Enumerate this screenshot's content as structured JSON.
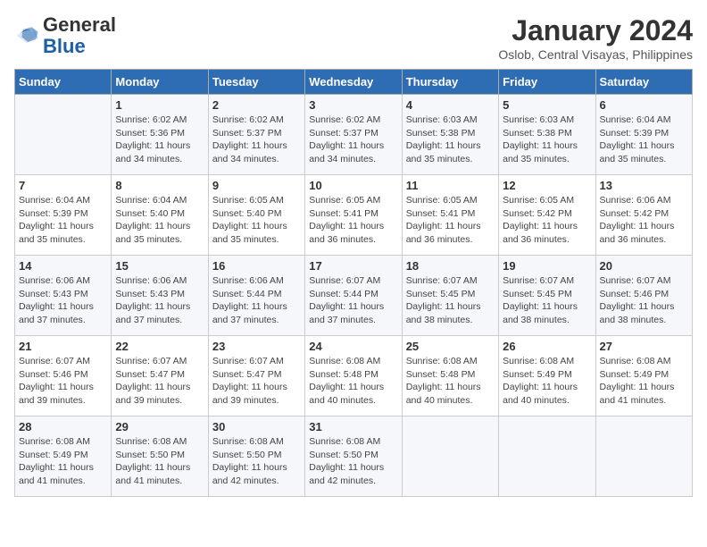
{
  "header": {
    "logo_general": "General",
    "logo_blue": "Blue",
    "month_title": "January 2024",
    "location": "Oslob, Central Visayas, Philippines"
  },
  "weekdays": [
    "Sunday",
    "Monday",
    "Tuesday",
    "Wednesday",
    "Thursday",
    "Friday",
    "Saturday"
  ],
  "weeks": [
    [
      {
        "day": "",
        "info": ""
      },
      {
        "day": "1",
        "info": "Sunrise: 6:02 AM\nSunset: 5:36 PM\nDaylight: 11 hours\nand 34 minutes."
      },
      {
        "day": "2",
        "info": "Sunrise: 6:02 AM\nSunset: 5:37 PM\nDaylight: 11 hours\nand 34 minutes."
      },
      {
        "day": "3",
        "info": "Sunrise: 6:02 AM\nSunset: 5:37 PM\nDaylight: 11 hours\nand 34 minutes."
      },
      {
        "day": "4",
        "info": "Sunrise: 6:03 AM\nSunset: 5:38 PM\nDaylight: 11 hours\nand 35 minutes."
      },
      {
        "day": "5",
        "info": "Sunrise: 6:03 AM\nSunset: 5:38 PM\nDaylight: 11 hours\nand 35 minutes."
      },
      {
        "day": "6",
        "info": "Sunrise: 6:04 AM\nSunset: 5:39 PM\nDaylight: 11 hours\nand 35 minutes."
      }
    ],
    [
      {
        "day": "7",
        "info": "Sunrise: 6:04 AM\nSunset: 5:39 PM\nDaylight: 11 hours\nand 35 minutes."
      },
      {
        "day": "8",
        "info": "Sunrise: 6:04 AM\nSunset: 5:40 PM\nDaylight: 11 hours\nand 35 minutes."
      },
      {
        "day": "9",
        "info": "Sunrise: 6:05 AM\nSunset: 5:40 PM\nDaylight: 11 hours\nand 35 minutes."
      },
      {
        "day": "10",
        "info": "Sunrise: 6:05 AM\nSunset: 5:41 PM\nDaylight: 11 hours\nand 36 minutes."
      },
      {
        "day": "11",
        "info": "Sunrise: 6:05 AM\nSunset: 5:41 PM\nDaylight: 11 hours\nand 36 minutes."
      },
      {
        "day": "12",
        "info": "Sunrise: 6:05 AM\nSunset: 5:42 PM\nDaylight: 11 hours\nand 36 minutes."
      },
      {
        "day": "13",
        "info": "Sunrise: 6:06 AM\nSunset: 5:42 PM\nDaylight: 11 hours\nand 36 minutes."
      }
    ],
    [
      {
        "day": "14",
        "info": "Sunrise: 6:06 AM\nSunset: 5:43 PM\nDaylight: 11 hours\nand 37 minutes."
      },
      {
        "day": "15",
        "info": "Sunrise: 6:06 AM\nSunset: 5:43 PM\nDaylight: 11 hours\nand 37 minutes."
      },
      {
        "day": "16",
        "info": "Sunrise: 6:06 AM\nSunset: 5:44 PM\nDaylight: 11 hours\nand 37 minutes."
      },
      {
        "day": "17",
        "info": "Sunrise: 6:07 AM\nSunset: 5:44 PM\nDaylight: 11 hours\nand 37 minutes."
      },
      {
        "day": "18",
        "info": "Sunrise: 6:07 AM\nSunset: 5:45 PM\nDaylight: 11 hours\nand 38 minutes."
      },
      {
        "day": "19",
        "info": "Sunrise: 6:07 AM\nSunset: 5:45 PM\nDaylight: 11 hours\nand 38 minutes."
      },
      {
        "day": "20",
        "info": "Sunrise: 6:07 AM\nSunset: 5:46 PM\nDaylight: 11 hours\nand 38 minutes."
      }
    ],
    [
      {
        "day": "21",
        "info": "Sunrise: 6:07 AM\nSunset: 5:46 PM\nDaylight: 11 hours\nand 39 minutes."
      },
      {
        "day": "22",
        "info": "Sunrise: 6:07 AM\nSunset: 5:47 PM\nDaylight: 11 hours\nand 39 minutes."
      },
      {
        "day": "23",
        "info": "Sunrise: 6:07 AM\nSunset: 5:47 PM\nDaylight: 11 hours\nand 39 minutes."
      },
      {
        "day": "24",
        "info": "Sunrise: 6:08 AM\nSunset: 5:48 PM\nDaylight: 11 hours\nand 40 minutes."
      },
      {
        "day": "25",
        "info": "Sunrise: 6:08 AM\nSunset: 5:48 PM\nDaylight: 11 hours\nand 40 minutes."
      },
      {
        "day": "26",
        "info": "Sunrise: 6:08 AM\nSunset: 5:49 PM\nDaylight: 11 hours\nand 40 minutes."
      },
      {
        "day": "27",
        "info": "Sunrise: 6:08 AM\nSunset: 5:49 PM\nDaylight: 11 hours\nand 41 minutes."
      }
    ],
    [
      {
        "day": "28",
        "info": "Sunrise: 6:08 AM\nSunset: 5:49 PM\nDaylight: 11 hours\nand 41 minutes."
      },
      {
        "day": "29",
        "info": "Sunrise: 6:08 AM\nSunset: 5:50 PM\nDaylight: 11 hours\nand 41 minutes."
      },
      {
        "day": "30",
        "info": "Sunrise: 6:08 AM\nSunset: 5:50 PM\nDaylight: 11 hours\nand 42 minutes."
      },
      {
        "day": "31",
        "info": "Sunrise: 6:08 AM\nSunset: 5:50 PM\nDaylight: 11 hours\nand 42 minutes."
      },
      {
        "day": "",
        "info": ""
      },
      {
        "day": "",
        "info": ""
      },
      {
        "day": "",
        "info": ""
      }
    ]
  ]
}
